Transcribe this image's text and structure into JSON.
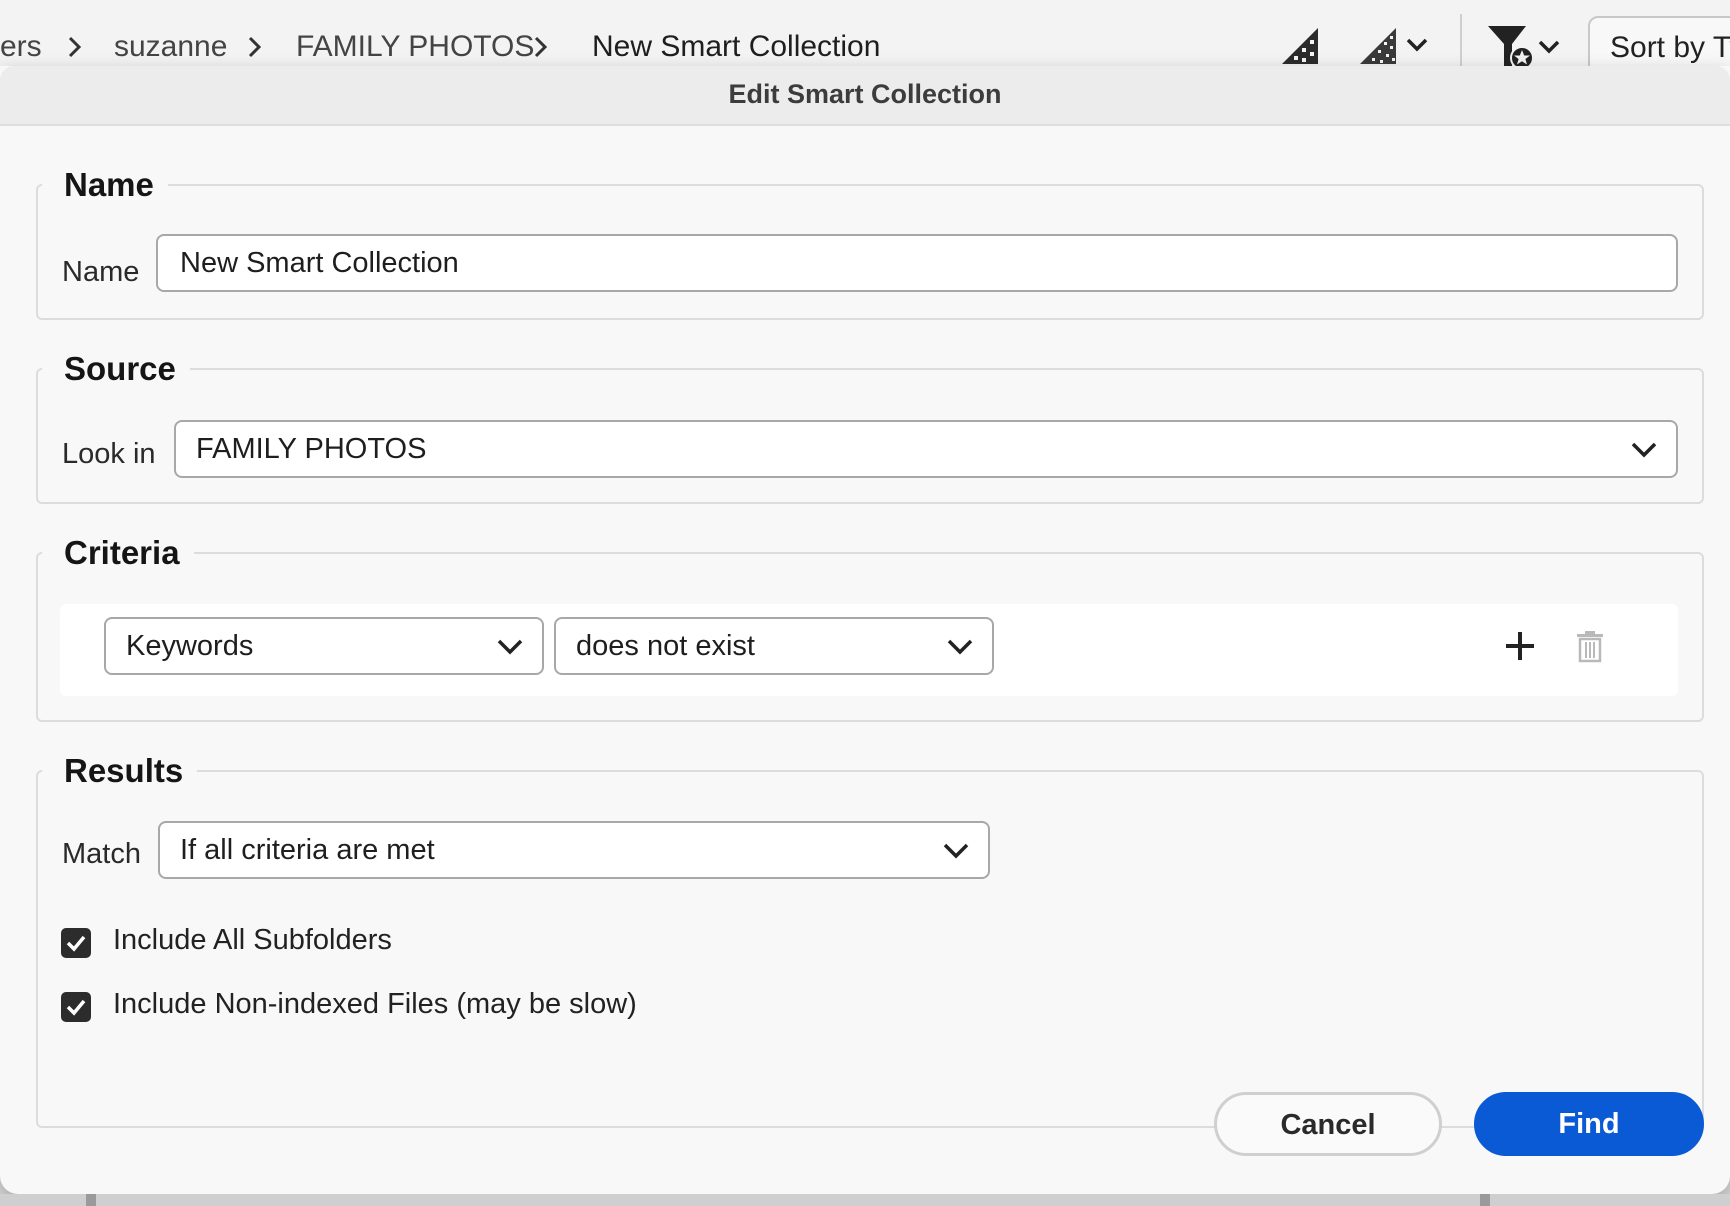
{
  "breadcrumb": {
    "items": [
      "ers",
      "suzanne",
      "FAMILY PHOTOS",
      "New Smart Collection"
    ]
  },
  "toolbar": {
    "icons": [
      "thumbnail-quality-icon",
      "thumbnail-quality-menu-icon",
      "filter-favorites-icon"
    ],
    "sort_label": "Sort by Ty"
  },
  "dialog": {
    "title": "Edit Smart Collection",
    "name_section": {
      "legend": "Name",
      "label": "Name",
      "value": "New Smart Collection"
    },
    "source_section": {
      "legend": "Source",
      "label": "Look in",
      "selected": "FAMILY PHOTOS"
    },
    "criteria_section": {
      "legend": "Criteria",
      "rows": [
        {
          "field": "Keywords",
          "operator": "does not exist"
        }
      ]
    },
    "results_section": {
      "legend": "Results",
      "match_label": "Match",
      "match_selected": "If all criteria are met",
      "checkboxes": [
        {
          "label": "Include All Subfolders",
          "checked": true
        },
        {
          "label": "Include Non-indexed Files (may be slow)",
          "checked": true
        }
      ]
    },
    "buttons": {
      "cancel": "Cancel",
      "find": "Find"
    }
  },
  "colors": {
    "accent": "#0a5ad6",
    "dialog_bg": "#f8f8f8"
  }
}
